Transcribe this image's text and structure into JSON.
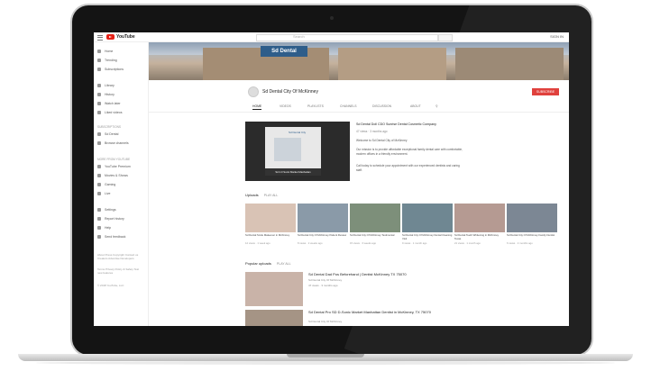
{
  "app": {
    "logo_text": "YouTube",
    "search_placeholder": "Search",
    "signin": "SIGN IN"
  },
  "sidebar": {
    "primary": [
      "Home",
      "Trending",
      "Subscriptions"
    ],
    "library": [
      "Library",
      "History",
      "Watch later",
      "Liked videos"
    ],
    "subs_heading": "SUBSCRIPTIONS",
    "subs": [
      "Sd&#8203;Dental",
      "Browse channels"
    ],
    "more_heading": "MORE FROM YOUTUBE",
    "more": [
      "YouTube Premium",
      "Movies & Shows",
      "Gaming",
      "Live"
    ],
    "settings": [
      "Settings",
      "Report history",
      "Help",
      "Send feedback"
    ],
    "notes": "About Press Copyright Contact us Creators Advertise Developers",
    "notes2": "Terms Privacy Policy & Safety Test new features",
    "copyright": "© 2018 YouTube, LLC"
  },
  "banner": {
    "sign_text": "Sd Dental"
  },
  "channel": {
    "name": "Sd Dental City Of McKinney",
    "subscribe": "SUBSCRIBE"
  },
  "tabs": [
    "HOME",
    "VIDEOS",
    "PLAYLISTS",
    "CHANNELS",
    "DISCUSSION",
    "ABOUT"
  ],
  "feature": {
    "overlay_name": "Sd Dental City",
    "caption": "Sd 2.0 Sonic Market Manhattan",
    "title": "Sd Dental Doll CDO Sunrise Dental Cosmetic Company",
    "meta": "47 views · 3 months ago",
    "lines": [
      "Welcome to Sd Dental City of McKinney",
      "Our mission is to provide affordable exceptional family dental care with comfortable, modern offices in a friendly environment.",
      "Call today to schedule your appointment with our experienced dentists and caring staff."
    ]
  },
  "uploads": {
    "title": "Uploads",
    "play_all": "PLAY ALL",
    "videos": [
      {
        "title": "Sd Dental Smile Makeover in McKinney",
        "meta": "12 views · 1 week ago"
      },
      {
        "title": "Sd Dental City Of McKinney Patient Review",
        "meta": "8 views · 2 weeks ago"
      },
      {
        "title": "Sd Dental City Of McKinney Testimonial",
        "meta": "15 views · 3 weeks ago"
      },
      {
        "title": "Sd Dental City Of McKinney Dental Cleaning Visit",
        "meta": "9 views · 1 month ago"
      },
      {
        "title": "Sd Dental Teeth Whitening in McKinney Texas",
        "meta": "21 views · 1 month ago"
      },
      {
        "title": "Sd Dental City Of McKinney Family Dentist",
        "meta": "6 views · 2 months ago"
      }
    ]
  },
  "popular": {
    "title": "Popular uploads",
    "play_all": "PLAY ALL",
    "videos": [
      {
        "title": "Sd Dental Dad Pos Beforehand | Dentist McKinney TX 75070",
        "channel": "Sd Dental City Of McKinney",
        "meta": "47 views · 3 months ago"
      },
      {
        "title": "Sd Dental Pro SD D-Sonic Market Manhattan Dentist in McKinney, TX 75070",
        "channel": "Sd Dental City Of McKinney",
        "meta": "23 views · 3 months ago"
      }
    ]
  }
}
